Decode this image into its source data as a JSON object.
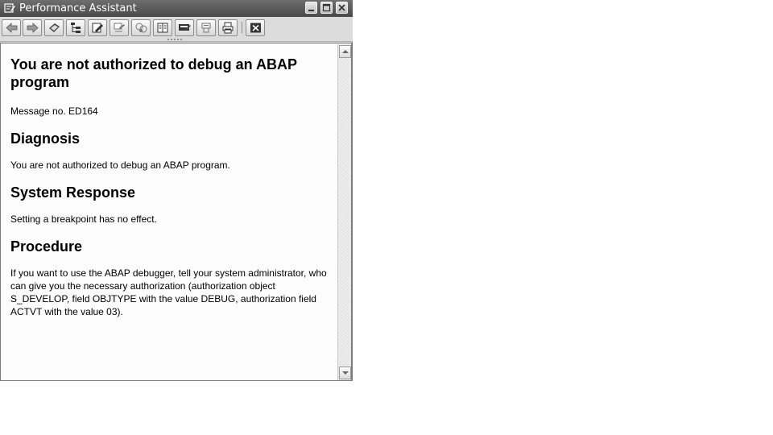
{
  "window": {
    "title": "Performance Assistant"
  },
  "titlebar": {
    "controls": [
      "minimize-icon",
      "maximize-icon",
      "close-icon"
    ]
  },
  "toolbar": {
    "buttons": [
      {
        "icon": "back-arrow-icon"
      },
      {
        "icon": "forward-arrow-icon"
      },
      {
        "icon": "technical-info-icon"
      },
      {
        "icon": "hierarchy-icon"
      },
      {
        "icon": "edit-notes-icon"
      },
      {
        "icon": "display-notes-icon"
      },
      {
        "icon": "application-help-icon"
      },
      {
        "icon": "glossary-icon"
      },
      {
        "icon": "release-notes-icon"
      },
      {
        "icon": "settings-icon"
      },
      {
        "icon": "print-icon"
      },
      {
        "icon": "close-box-icon"
      }
    ]
  },
  "document": {
    "heading": "You are not authorized to debug an ABAP program",
    "message_no": "Message no. ED164",
    "sections": [
      {
        "title": "Diagnosis",
        "body": "You are not authorized to debug an ABAP program."
      },
      {
        "title": "System Response",
        "body": "Setting a breakpoint has no effect."
      },
      {
        "title": "Procedure",
        "body": "If you want to use the ABAP debugger, tell your system administrator, who can give you the necessary authorization (authorization object S_DEVELOP, field OBJTYPE with the value DEBUG, authorization field ACTVT with the value 03)."
      }
    ]
  },
  "colors": {
    "titlebar": "#5a5a5a",
    "toolbar": "#dcdcdc",
    "content_bg": "#fcfcfc",
    "text": "#000000"
  }
}
